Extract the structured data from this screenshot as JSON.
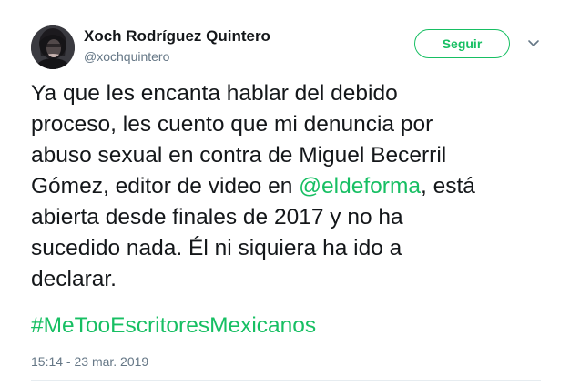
{
  "author": {
    "display_name": "Xoch Rodríguez Quintero",
    "handle": "@xochquintero"
  },
  "follow_button": {
    "label": "Seguir"
  },
  "tweet": {
    "lines": [
      "Ya que les encanta hablar del debido",
      "proceso, les cuento que mi denuncia por",
      "abuso sexual en contra de Miguel Becerril"
    ],
    "line4_before": "Gómez, editor de video en ",
    "mention": "@eldeforma",
    "line4_after": ", está",
    "lines_after": [
      "abierta desde finales de 2017 y no ha",
      "sucedido nada. Él ni siquiera ha ido a",
      "declarar."
    ],
    "hashtag": "#MeTooEscritoresMexicanos",
    "timestamp": "15:14 - 23 mar. 2019"
  },
  "colors": {
    "accent": "#17bf63",
    "text": "#14171a",
    "secondary": "#657786"
  },
  "icons": {
    "caret": "chevron-down-icon"
  }
}
